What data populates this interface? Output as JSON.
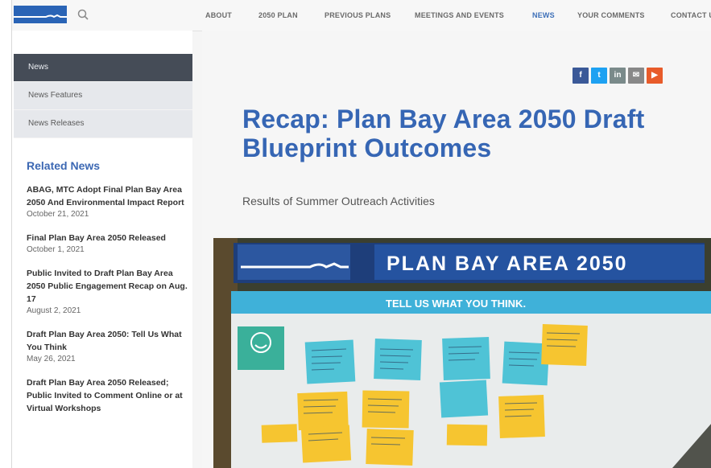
{
  "nav": {
    "items": [
      "ABOUT",
      "2050 PLAN",
      "PREVIOUS PLANS",
      "MEETINGS AND EVENTS",
      "NEWS",
      "YOUR COMMENTS",
      "CONTACT U"
    ],
    "active": "NEWS"
  },
  "sidebar": {
    "menu": [
      {
        "label": "News",
        "active": true
      },
      {
        "label": "News Features",
        "active": false
      },
      {
        "label": "News Releases",
        "active": false
      }
    ],
    "related_title": "Related News",
    "related": [
      {
        "title": "ABAG, MTC Adopt Final Plan Bay Area 2050 And Environmental Impact Report",
        "date": "October 21, 2021"
      },
      {
        "title": "Final Plan Bay Area 2050 Released",
        "date": "October 1, 2021"
      },
      {
        "title": "Public Invited to Draft Plan Bay Area 2050 Public Engagement Recap on Aug. 17",
        "date": "August 2, 2021"
      },
      {
        "title": "Draft Plan Bay Area 2050: Tell Us What You Think",
        "date": "May 26, 2021"
      },
      {
        "title": "Draft Plan Bay Area 2050 Released; Public Invited to Comment Online or at Virtual Workshops",
        "date": ""
      }
    ]
  },
  "article": {
    "title": "Recap: Plan Bay Area 2050 Draft Blueprint Outcomes",
    "subtitle": "Results of Summer Outreach Activities"
  },
  "share": [
    {
      "icon": "facebook-icon",
      "glyph": "f",
      "color": "#3b5998"
    },
    {
      "icon": "twitter-icon",
      "glyph": "t",
      "color": "#1da1f2"
    },
    {
      "icon": "linkedin-icon",
      "glyph": "in",
      "color": "#7a8a8a"
    },
    {
      "icon": "email-icon",
      "glyph": "✉",
      "color": "#888888"
    },
    {
      "icon": "youtube-icon",
      "glyph": "▶",
      "color": "#e85b2a"
    }
  ],
  "hero": {
    "banner_text": "PLAN BAY AREA 2050",
    "board_header": "TELL US WHAT YOU THINK."
  },
  "colors": {
    "accent": "#3666b4",
    "sidebar_active": "#454c57",
    "banner": "#2c57a0",
    "board_header": "#3fb1d9",
    "note_teal": "#4fc3d6",
    "note_yellow": "#f6c530"
  }
}
